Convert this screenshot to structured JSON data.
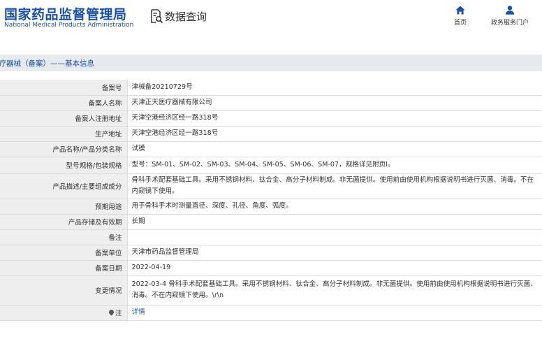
{
  "header": {
    "logo_cn": "国家药品监督管理局",
    "logo_en": "National Medical Products Administration",
    "query_label": "数据查询",
    "nav": [
      {
        "label": "首页",
        "icon": "home-icon"
      },
      {
        "label": "政务服务门户",
        "icon": "user-icon"
      }
    ]
  },
  "section": {
    "title": "医疗器械（备案）——基本信息"
  },
  "rows": [
    {
      "label": "备案号",
      "value": "津械备20210729号"
    },
    {
      "label": "备案人名称",
      "value": "天津正天医疗器械有限公司"
    },
    {
      "label": "备案人注册地址",
      "value": "天津空港经济区经一路318号"
    },
    {
      "label": "生产地址",
      "value": "天津空港经济区经一路318号"
    },
    {
      "label": "产品名称/产品分类名称",
      "value": "试模"
    },
    {
      "label": "型号规格/包装规格",
      "value": "型号：SM-01、SM-02、SM-03、SM-04、SM-05、SM-06、SM-07，规格详见附页Ⅰ。"
    },
    {
      "label": "产品描述/主要组成成分",
      "value": "骨科手术配套基础工具。采用不锈钢材料、钛合金、高分子材料制成。非无菌提供。使用前由使用机构根据说明书进行灭菌、消毒。不在内窥镜下使用。"
    },
    {
      "label": "预期用途",
      "value": "用于骨科手术时测量直径、深度、孔径、角度、弧度。"
    },
    {
      "label": "产品存储及有效期",
      "value": "长期"
    },
    {
      "label": "备注",
      "value": ""
    },
    {
      "label": "备案单位",
      "value": "天津市药品监督管理局"
    },
    {
      "label": "备案日期",
      "value": "2022-04-19"
    },
    {
      "label": "变更情况",
      "value": "2022-03-4 骨科手术配套基础工具。采用不锈钢材料、钛合金、高分子材料制成。非无菌提供。使用前由使用机构根据说明书进行灭菌、消毒。不在内窥镜下使用。\\r\\n"
    },
    {
      "label": "注",
      "value": "详情"
    }
  ],
  "colors": {
    "brand": "#1a52a8",
    "label_bg": "#eeeeee",
    "section_bg": "#e6e9ee"
  }
}
